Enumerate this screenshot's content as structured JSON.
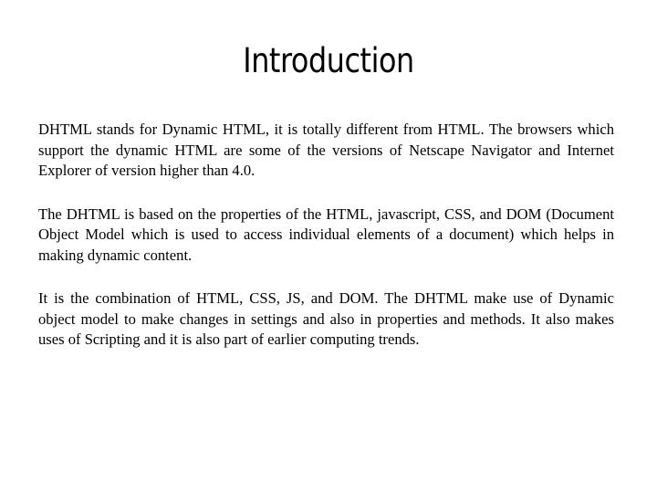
{
  "slide": {
    "title": "Introduction",
    "paragraphs": [
      "DHTML stands for Dynamic HTML, it is totally different from HTML. The browsers which support the dynamic HTML are some of the versions of Netscape Navigator and Internet Explorer of version higher than 4.0.",
      "The DHTML is based on the properties of the HTML, javascript, CSS, and DOM (Document Object Model which is used to access individual elements of a document) which helps in making dynamic content.",
      "It is the combination of HTML, CSS, JS, and DOM. The DHTML make use of Dynamic object model to make changes in settings and also in properties and methods. It also makes uses of Scripting and it is also part of earlier computing trends."
    ]
  }
}
